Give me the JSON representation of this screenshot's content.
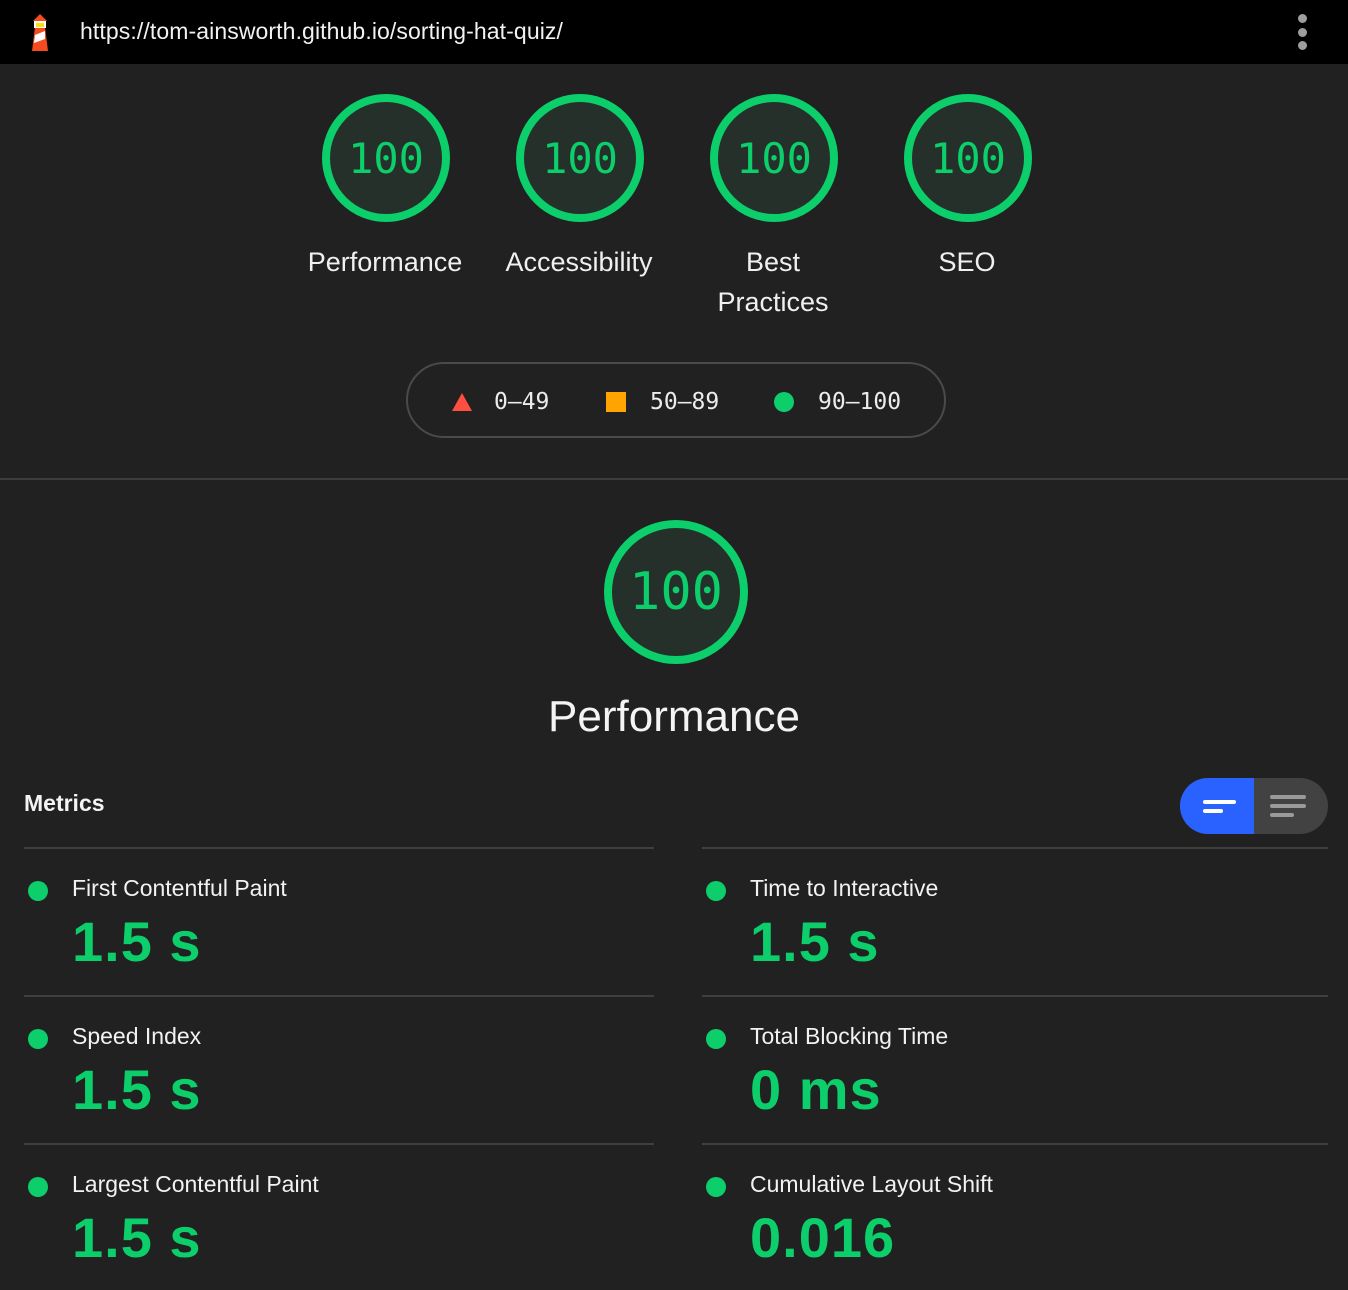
{
  "browser": {
    "url": "https://tom-ainsworth.github.io/sorting-hat-quiz/",
    "logo_icon": "lighthouse-icon",
    "menu_icon": "kebab-menu-icon"
  },
  "scores": [
    {
      "value": "100",
      "label": "Performance"
    },
    {
      "value": "100",
      "label": "Accessibility"
    },
    {
      "value": "100",
      "label_line1": "Best",
      "label_line2": "Practices"
    },
    {
      "value": "100",
      "label": "SEO"
    }
  ],
  "legend": {
    "fail": "0–49",
    "average": "50–89",
    "pass": "90–100",
    "colors": {
      "fail": "#ff4e42",
      "average": "#ffa400",
      "pass": "#0cce6b"
    }
  },
  "category": {
    "score": "100",
    "title": "Performance"
  },
  "metrics": {
    "title": "Metrics",
    "view_toggle": [
      "compact-view-icon",
      "expanded-view-icon"
    ],
    "items": [
      {
        "name": "First Contentful Paint",
        "value": "1.5 s"
      },
      {
        "name": "Time to Interactive",
        "value": "1.5 s"
      },
      {
        "name": "Speed Index",
        "value": "1.5 s"
      },
      {
        "name": "Total Blocking Time",
        "value": "0 ms"
      },
      {
        "name": "Largest Contentful Paint",
        "value": "1.5 s"
      },
      {
        "name": "Cumulative Layout Shift",
        "value": "0.016"
      }
    ]
  }
}
